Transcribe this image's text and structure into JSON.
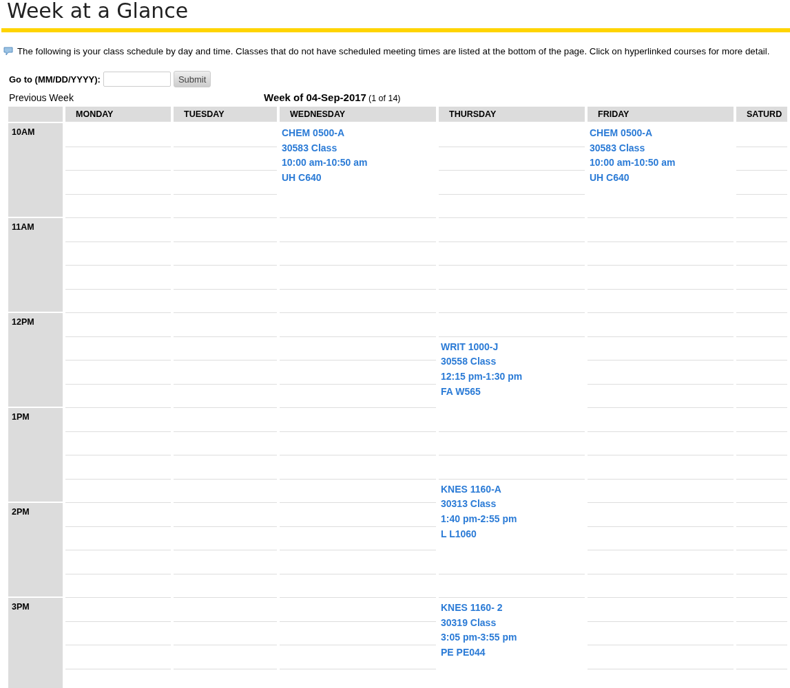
{
  "title": "Week at a Glance",
  "instructions": "The following is your class schedule by day and time. Classes that do not have scheduled meeting times are listed at the bottom of the page. Click on hyperlinked courses for more detail.",
  "goto": {
    "label": "Go to (MM/DD/YYYY):",
    "button": "Submit"
  },
  "previous_week": "Previous Week",
  "week_title": "Week of 04-Sep-2017",
  "week_count": "(1 of 14)",
  "hours": [
    "10AM",
    "11AM",
    "12PM",
    "1PM",
    "2PM",
    "3PM"
  ],
  "days": [
    {
      "label": "MONDAY"
    },
    {
      "label": "TUESDAY"
    },
    {
      "label": "WEDNESDAY",
      "slots": [
        {
          "kind": "class",
          "lines": [
            "CHEM 0500-A",
            "30583 Class",
            "10:00 am-10:50 am",
            "UH C640"
          ]
        }
      ]
    },
    {
      "label": "THURSDAY",
      "slots": [
        {
          "kind": "empty"
        },
        {
          "kind": "empty"
        },
        {
          "kind": "empty"
        },
        {
          "kind": "empty"
        },
        {
          "kind": "empty"
        },
        {
          "kind": "empty"
        },
        {
          "kind": "empty"
        },
        {
          "kind": "empty"
        },
        {
          "kind": "empty"
        },
        {
          "kind": "class",
          "lines": [
            "WRIT 1000-J",
            "30558 Class",
            "12:15 pm-1:30 pm",
            "FA W565"
          ]
        },
        {
          "kind": "empty"
        },
        {
          "kind": "empty"
        },
        {
          "kind": "class",
          "lines": [
            "KNES 1160-A",
            "30313 Class",
            "1:40 pm-2:55 pm",
            "L L1060"
          ]
        },
        {
          "kind": "empty"
        },
        {
          "kind": "class",
          "lines": [
            "KNES 1160- 2",
            "30319 Class",
            "3:05 pm-3:55 pm",
            "PE PE044"
          ]
        }
      ]
    },
    {
      "label": "FRIDAY",
      "slots": [
        {
          "kind": "class",
          "lines": [
            "CHEM 0500-A",
            "30583 Class",
            "10:00 am-10:50 am",
            "UH C640"
          ]
        }
      ]
    },
    {
      "label": "SATURD"
    }
  ]
}
